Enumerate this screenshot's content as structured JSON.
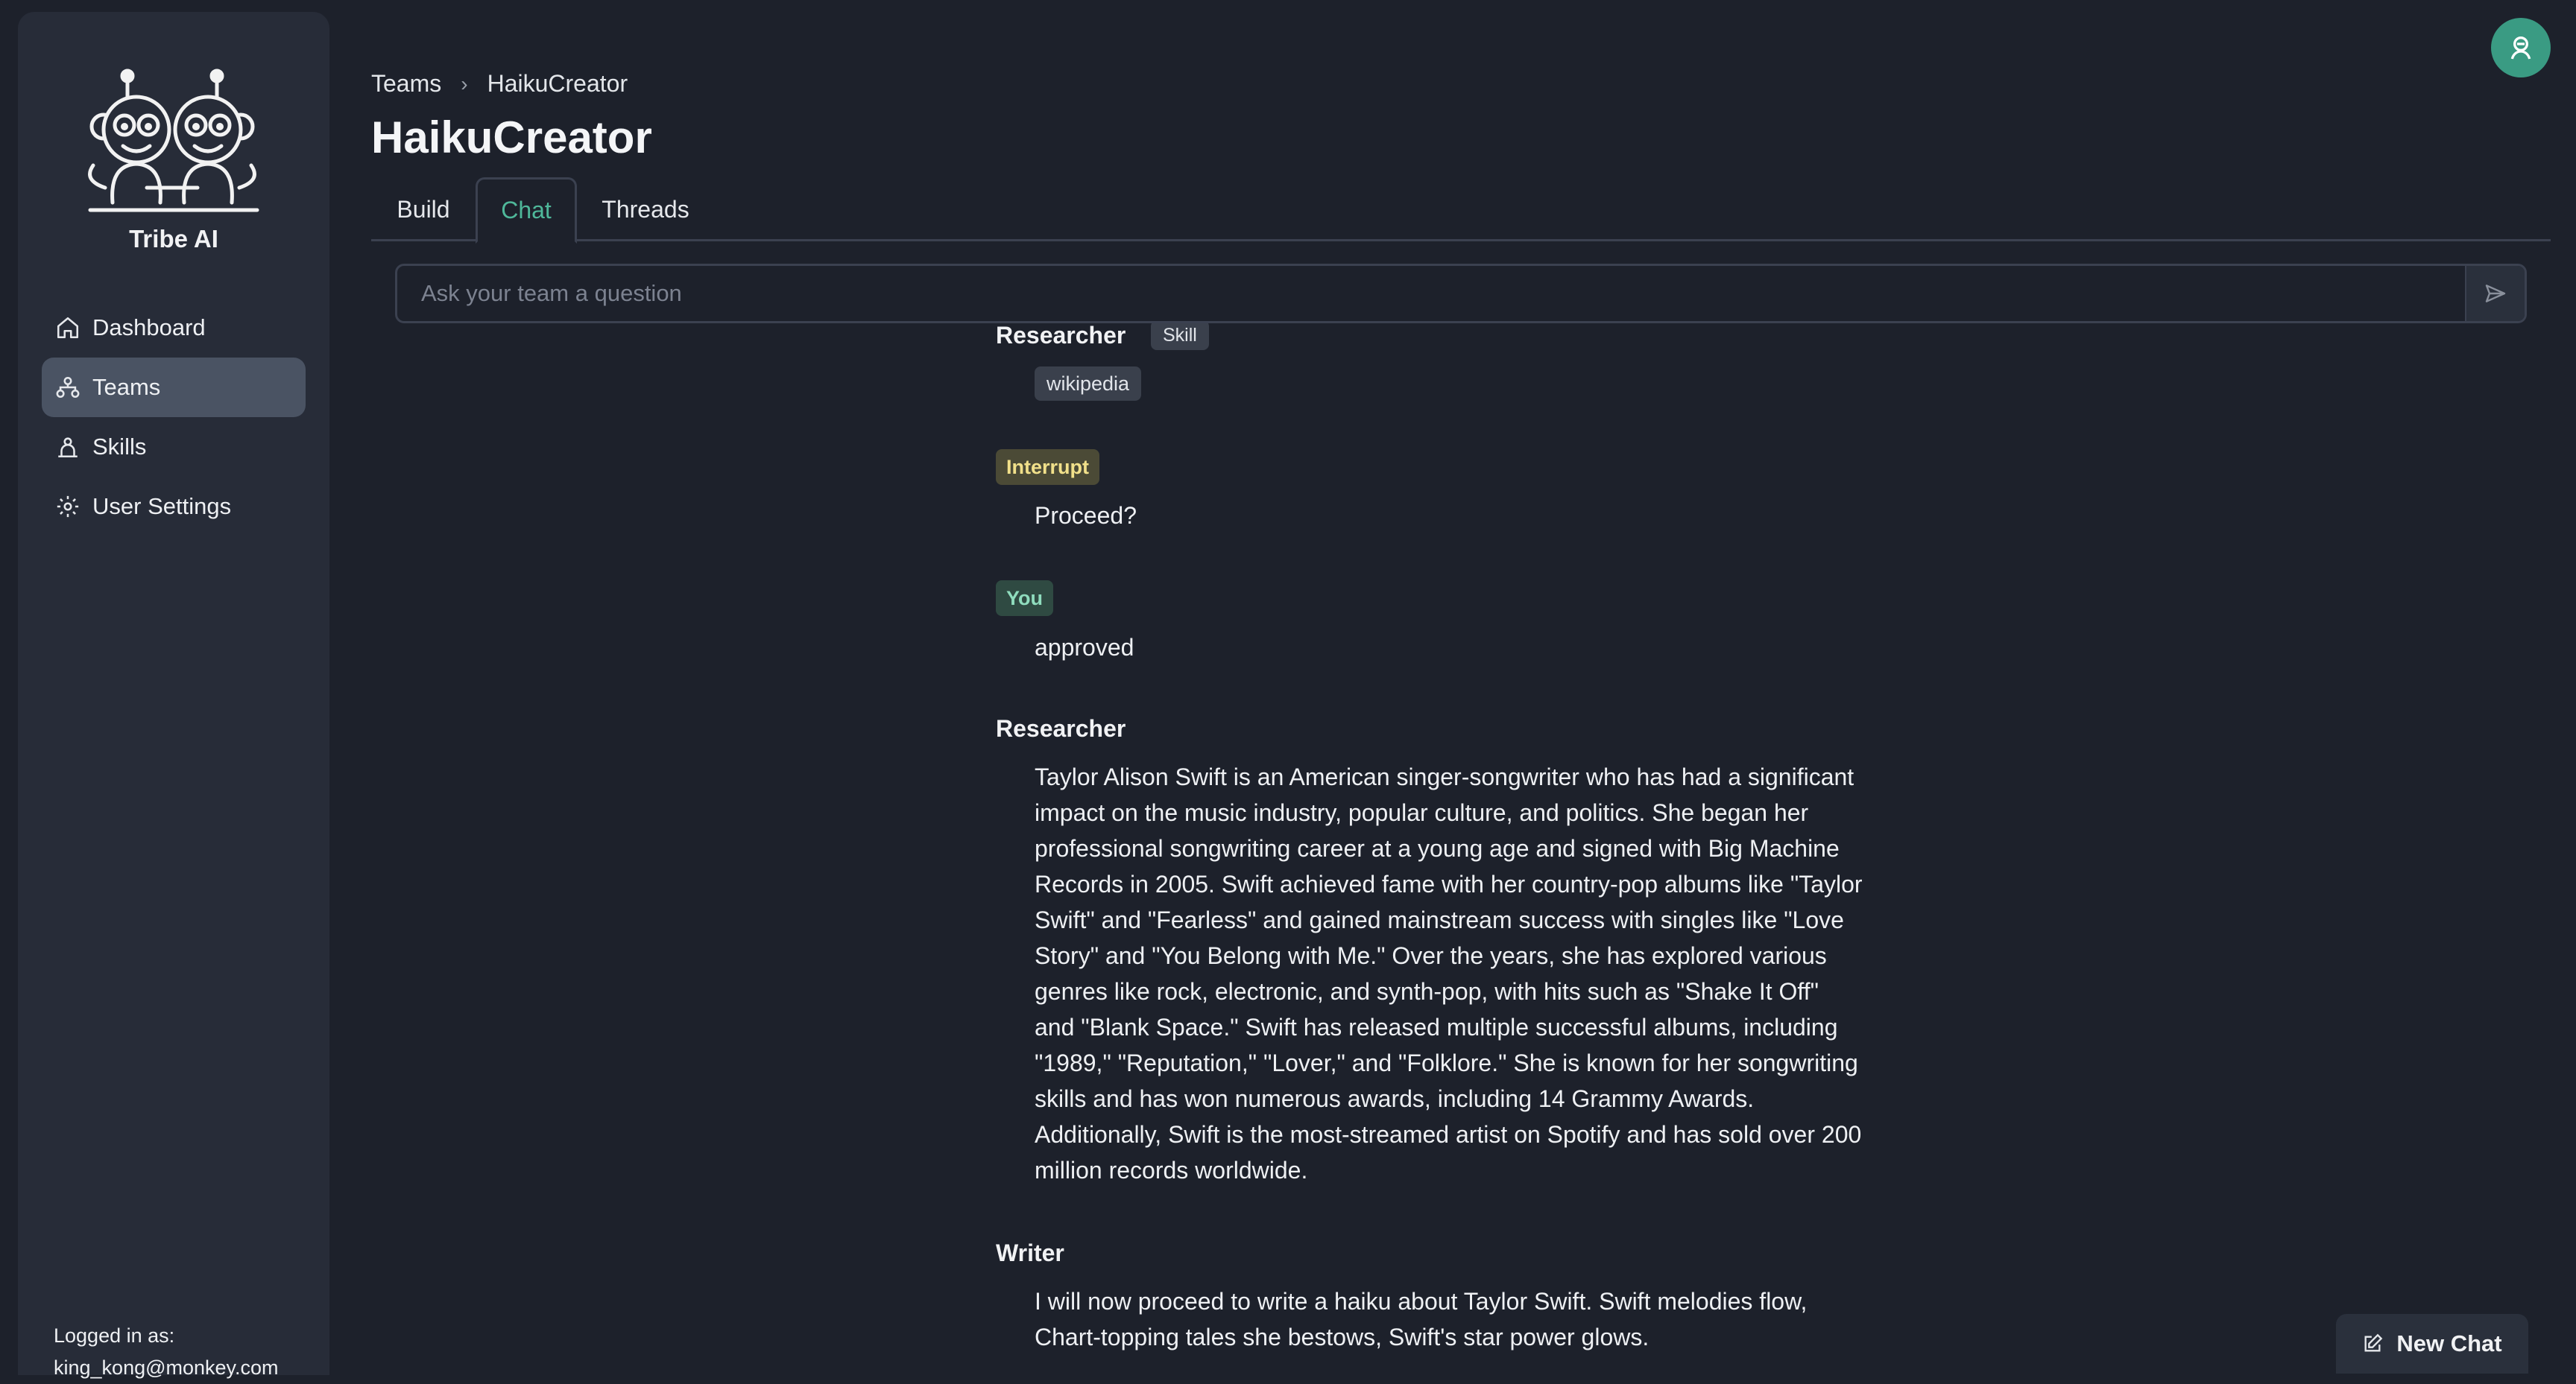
{
  "brand": {
    "name": "Tribe AI",
    "logo_icon": "twin-monkeys-logo-icon"
  },
  "sidebar": {
    "items": [
      {
        "label": "Dashboard",
        "icon": "home-icon",
        "active": false
      },
      {
        "label": "Teams",
        "icon": "teams-icon",
        "active": true
      },
      {
        "label": "Skills",
        "icon": "skills-icon",
        "active": false
      },
      {
        "label": "User Settings",
        "icon": "gear-icon",
        "active": false
      }
    ],
    "login_label": "Logged in as:",
    "login_user": "king_kong@monkey.com"
  },
  "breadcrumb": {
    "root": "Teams",
    "current": "HaikuCreator"
  },
  "page": {
    "title": "HaikuCreator"
  },
  "tabs": [
    {
      "label": "Build",
      "active": false
    },
    {
      "label": "Chat",
      "active": true
    },
    {
      "label": "Threads",
      "active": false
    }
  ],
  "chat_input": {
    "placeholder": "Ask your team a question",
    "value": ""
  },
  "messages": {
    "m1": {
      "sender": "Researcher",
      "tag": "Skill",
      "skill": "wikipedia"
    },
    "m2": {
      "badge": "Interrupt",
      "text": "Proceed?"
    },
    "m3": {
      "badge": "You",
      "text": "approved"
    },
    "m4": {
      "sender": "Researcher",
      "lines": [
        "Taylor Alison Swift is an American singer-songwriter who has had a significant",
        "impact on the music industry, popular culture, and politics. She began her",
        "professional songwriting career at a young age and signed with Big Machine",
        "Records in 2005. Swift achieved fame with her country-pop albums like \"Taylor",
        "Swift\" and \"Fearless\" and gained mainstream success with singles like \"Love",
        "Story\" and \"You Belong with Me.\" Over the years, she has explored various",
        "genres like rock, electronic, and synth-pop, with hits such as \"Shake It Off\"",
        "and \"Blank Space.\" Swift has released multiple successful albums, including",
        "\"1989,\" \"Reputation,\" \"Lover,\" and \"Folklore.\" She is known for her songwriting",
        "skills and has won numerous awards, including 14 Grammy Awards.",
        "Additionally, Swift is the most-streamed artist on Spotify and has sold over 200",
        "million records worldwide."
      ]
    },
    "m5": {
      "sender": "Writer",
      "lines": [
        "I will now proceed to write a haiku about Taylor Swift. Swift melodies flow,",
        "Chart-topping tales she bestows, Swift's star power glows."
      ]
    }
  },
  "actions": {
    "new_chat_label": "New Chat"
  },
  "colors": {
    "accent": "#3a9b83",
    "active_tab": "#4fb89a",
    "background": "#1d212b",
    "sidebar": "#272c38"
  }
}
